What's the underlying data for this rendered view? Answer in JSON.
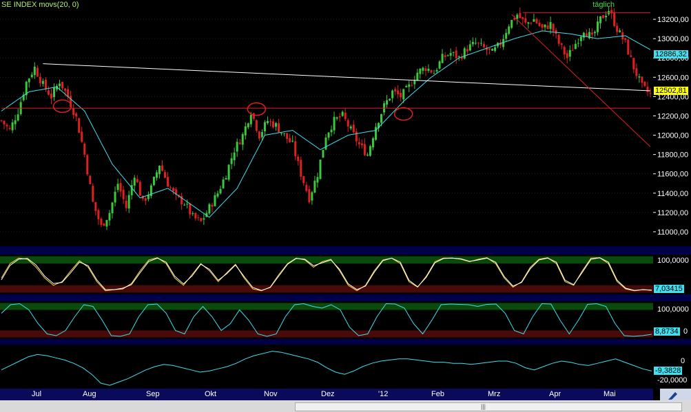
{
  "header": {
    "title": "SE INDEX movs(20, 0)",
    "interval": "täglich"
  },
  "chart_data": [
    {
      "type": "candlestick",
      "title": "SE INDEX movs(20, 0)",
      "ylim": [
        10850,
        13400
      ],
      "y_ticks": [
        "13200,00",
        "13000,00",
        "12800,00",
        "12600,00",
        "12400,00",
        "12200,00",
        "12000,00",
        "11800,00",
        "11600,00",
        "11400,00",
        "11200,00",
        "11000,00"
      ],
      "y_tick_values": [
        13200,
        13000,
        12800,
        12600,
        12400,
        12200,
        12000,
        11800,
        11600,
        11400,
        11200,
        11000
      ],
      "last_ma_label": "12886,32",
      "last_close_label": "12502,81",
      "last_ma": 12886.32,
      "last_close": 12502.81,
      "close_keypoints": [
        [
          0,
          12150
        ],
        [
          3,
          12050
        ],
        [
          6,
          12250
        ],
        [
          9,
          12550
        ],
        [
          12,
          12700
        ],
        [
          15,
          12520
        ],
        [
          18,
          12400
        ],
        [
          21,
          12560
        ],
        [
          24,
          12400
        ],
        [
          27,
          12180
        ],
        [
          30,
          11800
        ],
        [
          33,
          11300
        ],
        [
          36,
          11050
        ],
        [
          39,
          11200
        ],
        [
          42,
          11500
        ],
        [
          45,
          11250
        ],
        [
          48,
          11600
        ],
        [
          51,
          11300
        ],
        [
          54,
          11450
        ],
        [
          57,
          11700
        ],
        [
          60,
          11500
        ],
        [
          63,
          11350
        ],
        [
          66,
          11300
        ],
        [
          69,
          11150
        ],
        [
          72,
          11100
        ],
        [
          75,
          11250
        ],
        [
          78,
          11400
        ],
        [
          81,
          11600
        ],
        [
          84,
          11850
        ],
        [
          87,
          12000
        ],
        [
          90,
          12250
        ],
        [
          93,
          12000
        ],
        [
          96,
          12150
        ],
        [
          99,
          12100
        ],
        [
          102,
          12000
        ],
        [
          105,
          11900
        ],
        [
          108,
          11600
        ],
        [
          111,
          11350
        ],
        [
          114,
          11600
        ],
        [
          117,
          12000
        ],
        [
          120,
          12150
        ],
        [
          123,
          12200
        ],
        [
          126,
          12050
        ],
        [
          129,
          11900
        ],
        [
          132,
          11800
        ],
        [
          135,
          12100
        ],
        [
          138,
          12300
        ],
        [
          141,
          12450
        ],
        [
          144,
          12400
        ],
        [
          147,
          12500
        ],
        [
          150,
          12650
        ],
        [
          153,
          12700
        ],
        [
          156,
          12650
        ],
        [
          159,
          12800
        ],
        [
          162,
          12850
        ],
        [
          165,
          12800
        ],
        [
          168,
          12900
        ],
        [
          171,
          12950
        ],
        [
          174,
          12900
        ],
        [
          177,
          12850
        ],
        [
          180,
          12950
        ],
        [
          183,
          13150
        ],
        [
          186,
          13250
        ],
        [
          189,
          13150
        ],
        [
          192,
          13200
        ],
        [
          195,
          13100
        ],
        [
          198,
          13150
        ],
        [
          201,
          12950
        ],
        [
          204,
          12800
        ],
        [
          207,
          12950
        ],
        [
          210,
          13100
        ],
        [
          213,
          13000
        ],
        [
          216,
          13200
        ],
        [
          219,
          13300
        ],
        [
          222,
          13100
        ],
        [
          225,
          12950
        ],
        [
          228,
          12700
        ],
        [
          231,
          12500
        ],
        [
          234,
          12420
        ]
      ],
      "ma_keypoints": [
        [
          0,
          12250
        ],
        [
          10,
          12450
        ],
        [
          20,
          12500
        ],
        [
          30,
          12250
        ],
        [
          40,
          11700
        ],
        [
          50,
          11350
        ],
        [
          60,
          11450
        ],
        [
          70,
          11250
        ],
        [
          75,
          11150
        ],
        [
          85,
          11450
        ],
        [
          95,
          12000
        ],
        [
          105,
          12050
        ],
        [
          115,
          11850
        ],
        [
          125,
          12000
        ],
        [
          135,
          12050
        ],
        [
          145,
          12350
        ],
        [
          155,
          12600
        ],
        [
          165,
          12800
        ],
        [
          175,
          12900
        ],
        [
          185,
          13000
        ],
        [
          195,
          13080
        ],
        [
          205,
          13050
        ],
        [
          215,
          13000
        ],
        [
          225,
          13030
        ],
        [
          234,
          12886
        ]
      ],
      "lines": [
        {
          "name": "horizontal-support",
          "color": "#e02020",
          "points": [
            [
              0,
              12280
            ],
            [
              234,
              12280
            ]
          ]
        },
        {
          "name": "long-trendline",
          "color": "#ffffff",
          "points": [
            [
              15,
              12740
            ],
            [
              234,
              12460
            ]
          ]
        },
        {
          "name": "top-resistance",
          "color": "#e02020",
          "points": [
            [
              188,
              13270
            ],
            [
              234,
              13270
            ]
          ]
        },
        {
          "name": "down-channel",
          "color": "#e02020",
          "points": [
            [
              184,
              13250
            ],
            [
              234,
              11880
            ]
          ]
        }
      ],
      "circles": [
        [
          22,
          12300
        ],
        [
          92,
          12270
        ],
        [
          145,
          12220
        ]
      ]
    },
    {
      "type": "line",
      "ylim": [
        -5,
        105
      ],
      "y_ticks": [
        "100,0000"
      ],
      "last_value_label": "7,03415",
      "overbought_band": [
        80,
        100
      ],
      "oversold_band": [
        0,
        20
      ],
      "series": [
        {
          "color": "#ffd23c",
          "values": [
            40,
            80,
            95,
            92,
            70,
            40,
            20,
            30,
            60,
            88,
            70,
            30,
            5,
            8,
            10,
            25,
            60,
            90,
            96,
            80,
            40,
            20,
            50,
            80,
            60,
            30,
            55,
            78,
            40,
            10,
            5,
            15,
            50,
            80,
            95,
            90,
            70,
            85,
            92,
            60,
            20,
            5,
            20,
            60,
            90,
            95,
            80,
            30,
            15,
            45,
            85,
            95,
            95,
            92,
            85,
            92,
            96,
            80,
            40,
            15,
            30,
            70,
            92,
            96,
            80,
            30,
            20,
            60,
            95,
            96,
            80,
            30,
            10,
            5,
            8,
            6
          ]
        },
        {
          "color": "#ffffff",
          "values": [
            35,
            75,
            92,
            94,
            76,
            45,
            25,
            28,
            55,
            84,
            74,
            35,
            8,
            8,
            12,
            22,
            55,
            86,
            95,
            84,
            45,
            24,
            46,
            78,
            64,
            34,
            52,
            76,
            44,
            14,
            6,
            14,
            46,
            78,
            94,
            92,
            74,
            82,
            90,
            64,
            24,
            8,
            18,
            56,
            88,
            95,
            84,
            34,
            16,
            42,
            82,
            94,
            95,
            93,
            86,
            90,
            95,
            84,
            44,
            18,
            28,
            66,
            90,
            95,
            84,
            34,
            22,
            56,
            92,
            96,
            84,
            34,
            12,
            6,
            8,
            7
          ]
        }
      ]
    },
    {
      "type": "line",
      "ylim": [
        -5,
        105
      ],
      "y_ticks": [
        "100,0000",
        "0"
      ],
      "last_value_label": "8,8734",
      "overbought_band": [
        80,
        100
      ],
      "oversold_band": [
        0,
        20
      ],
      "series": [
        {
          "color": "#40e0f0",
          "values": [
            70,
            95,
            98,
            80,
            40,
            10,
            5,
            20,
            60,
            95,
            90,
            50,
            5,
            3,
            10,
            60,
            95,
            97,
            70,
            20,
            10,
            60,
            90,
            60,
            20,
            40,
            80,
            50,
            10,
            3,
            10,
            60,
            95,
            98,
            90,
            85,
            95,
            80,
            30,
            5,
            10,
            60,
            98,
            97,
            85,
            40,
            10,
            50,
            95,
            97,
            96,
            95,
            90,
            96,
            97,
            70,
            20,
            10,
            60,
            98,
            97,
            50,
            10,
            50,
            96,
            98,
            90,
            40,
            5,
            3,
            5,
            9
          ]
        }
      ]
    },
    {
      "type": "line",
      "ylim": [
        -25,
        15
      ],
      "y_ticks": [
        "0",
        "-20,0000"
      ],
      "last_value_label": "-9,3828",
      "series": [
        {
          "color": "#40e0f0",
          "values": [
            -8,
            -4,
            0,
            4,
            6,
            5,
            3,
            1,
            -2,
            -6,
            -12,
            -20,
            -22,
            -19,
            -16,
            -12,
            -8,
            -5,
            -3,
            -4,
            -6,
            -8,
            -10,
            -9,
            -7,
            -5,
            -2,
            2,
            5,
            7,
            9,
            8,
            6,
            4,
            2,
            -1,
            -6,
            -10,
            -12,
            -9,
            -5,
            -2,
            0,
            1,
            2,
            2,
            1,
            0,
            -1,
            -1,
            -2,
            -2,
            -3,
            -2,
            -1,
            0,
            0,
            -2,
            -6,
            -8,
            -5,
            -2,
            0,
            -1,
            -3,
            -4,
            -2,
            0,
            2,
            -1,
            -4,
            -7,
            -9
          ]
        }
      ]
    }
  ],
  "months": [
    "Jul",
    "Aug",
    "Sep",
    "Okt",
    "Nov",
    "Dez",
    "'12",
    "Feb",
    "Mrz",
    "Apr",
    "Mai"
  ]
}
